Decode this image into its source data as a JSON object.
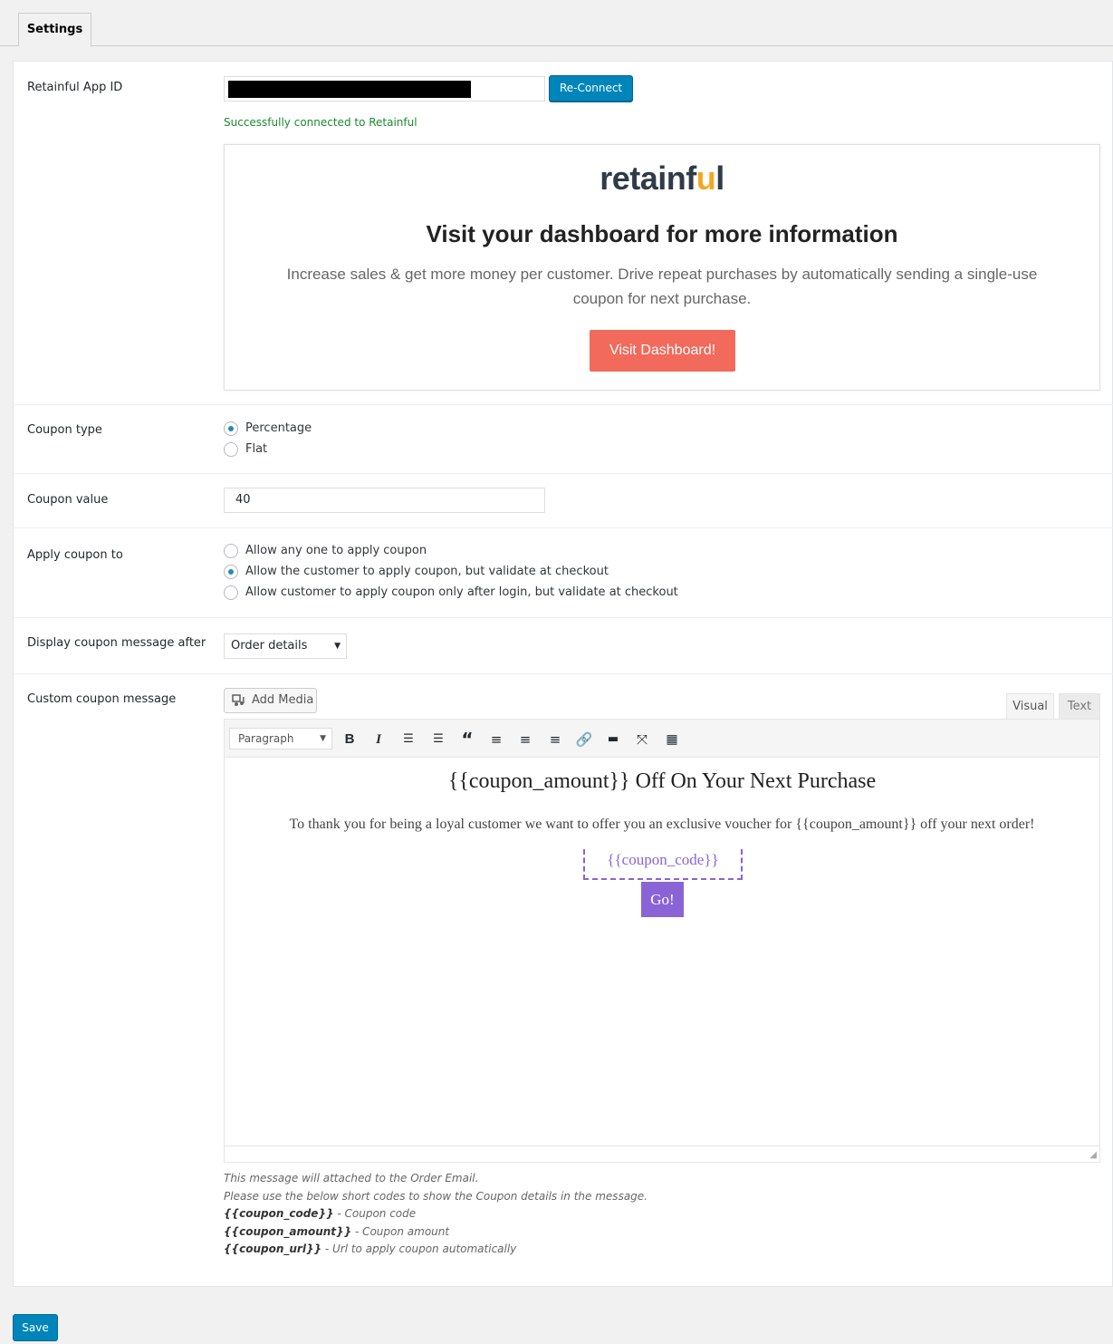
{
  "tabs": {
    "active_label": "Settings"
  },
  "app_id": {
    "label": "Retainful App ID",
    "reconnect_label": "Re-Connect",
    "status_text": "Successfully connected to Retainful"
  },
  "promo": {
    "logo_text_a": "retainf",
    "logo_text_b": "u",
    "logo_text_c": "l",
    "heading": "Visit your dashboard for more information",
    "body": "Increase sales & get more money per customer. Drive repeat purchases by automatically sending a single-use coupon for next purchase.",
    "button_label": "Visit Dashboard!"
  },
  "coupon_type": {
    "label": "Coupon type",
    "options": [
      "Percentage",
      "Flat"
    ],
    "selected": "Percentage"
  },
  "coupon_value": {
    "label": "Coupon value",
    "value": "40"
  },
  "apply_coupon": {
    "label": "Apply coupon to",
    "options": [
      "Allow any one to apply coupon",
      "Allow the customer to apply coupon, but validate at checkout",
      "Allow customer to apply coupon only after login, but validate at checkout"
    ],
    "selected": "Allow the customer to apply coupon, but validate at checkout"
  },
  "display_after": {
    "label": "Display coupon message after",
    "selected": "Order details"
  },
  "custom_message": {
    "label": "Custom coupon message",
    "add_media_label": "Add Media",
    "tab_visual": "Visual",
    "tab_text": "Text",
    "format_select": "Paragraph",
    "toolbar_icons": [
      "bold-icon",
      "italic-icon",
      "bullet-list-icon",
      "numbered-list-icon",
      "blockquote-icon",
      "align-left-icon",
      "align-center-icon",
      "align-right-icon",
      "link-icon",
      "read-more-icon",
      "fullscreen-icon",
      "toolbar-toggle-icon"
    ],
    "content_heading": "{{coupon_amount}} Off On Your Next Purchase",
    "content_body": "To thank you for being a loyal customer we want to offer you an exclusive voucher for {{coupon_amount}} off your next order!",
    "content_code": "{{coupon_code}}",
    "content_button": "Go!",
    "accent_color": "#8a64d6",
    "help": {
      "line1": "This message will attached to the Order Email.",
      "line2": "Please use the below short codes to show the Coupon details in the message.",
      "code1": "{{coupon_code}}",
      "code1_desc": " - Coupon code",
      "code2": "{{coupon_amount}}",
      "code2_desc": " - Coupon amount",
      "code3": "{{coupon_url}}",
      "code3_desc": " - Url to apply coupon automatically"
    }
  },
  "save_label": "Save",
  "colors": {
    "primary": "#0085ba",
    "promo_button": "#f26a5c",
    "success": "#1b8a2e"
  }
}
